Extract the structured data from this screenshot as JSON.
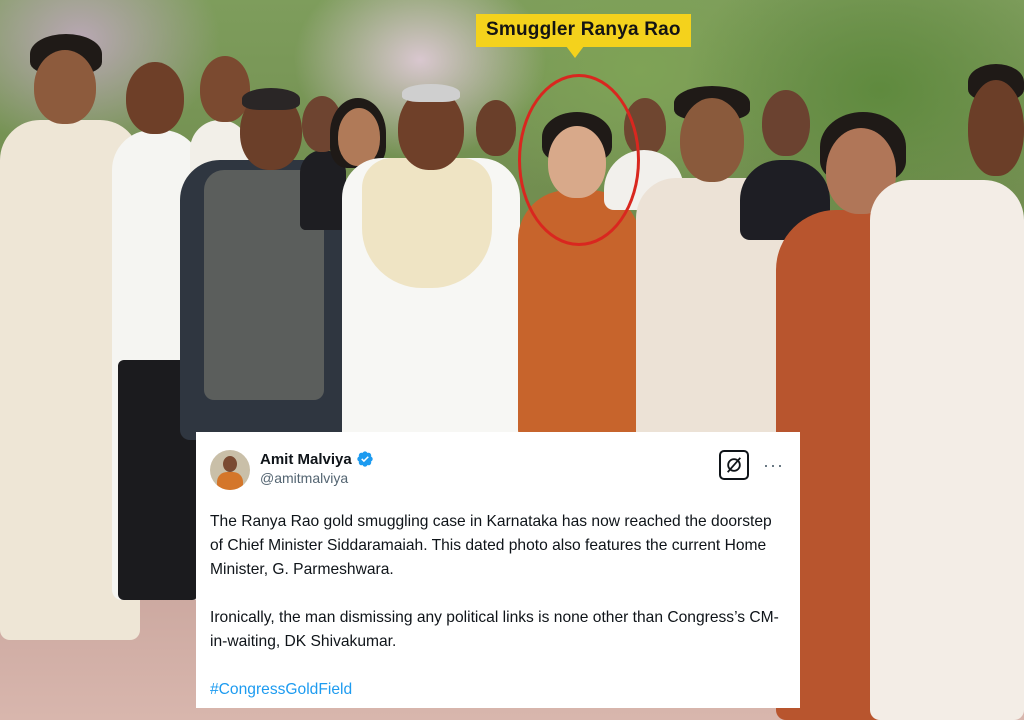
{
  "annotation": {
    "label": "Smuggler Ranya Rao",
    "label_color": "#f4d21c",
    "circle_color": "#d9271f"
  },
  "tweet": {
    "display_name": "Amit Malviya",
    "handle": "@amitmalviya",
    "verified_icon": "verified-badge-icon",
    "verified_color": "#1d9bf0",
    "grok_icon": "grok-icon",
    "more_icon": "more-dots-icon",
    "more_label": "···",
    "paragraph1": "The Ranya Rao gold smuggling case in Karnataka has now reached the doorstep of Chief Minister Siddaramaiah. This dated photo also features the current Home Minister, G. Parmeshwara.",
    "paragraph2": "Ironically, the man dismissing any political links is none other than Congress’s CM-in-waiting, DK Shivakumar.",
    "hashtag": "#CongressGoldField",
    "hashtag_color": "#1d9bf0"
  }
}
